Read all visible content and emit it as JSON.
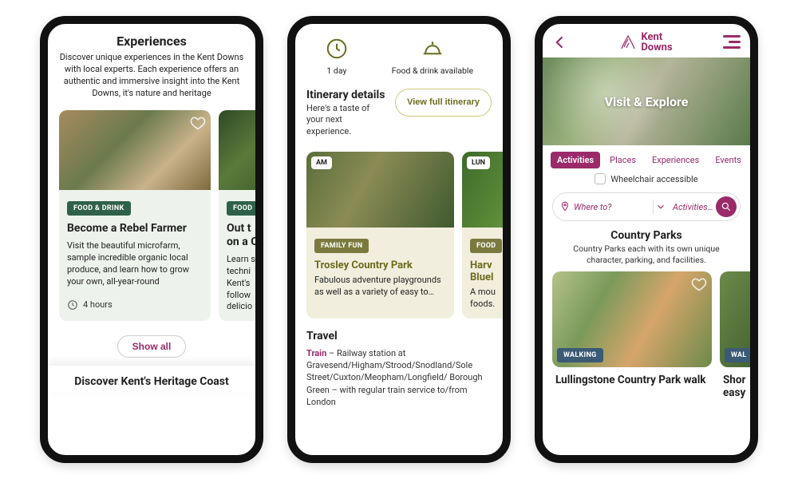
{
  "phone1": {
    "section_title": "Experiences",
    "section_desc": "Discover unique experiences in the Kent Downs with local experts. Each experience offers an authentic and immersive insight into the Kent Downs, it's nature and heritage",
    "card1": {
      "tag": "FOOD & DRINK",
      "title": "Become a Rebel Farmer",
      "desc": "Visit the beautiful microfarm, sample incredible organic local produce, and learn how to grow your own, all-year-round",
      "duration": "4 hours"
    },
    "card2": {
      "tag": "FOOD",
      "title_line1": "Out t",
      "title_line2": "on a C",
      "desc": "Learn s\ntechni\nKent's\nfollow\ndelicio"
    },
    "showall": "Show all",
    "footer_title": "Discover Kent's Heritage Coast"
  },
  "phone2": {
    "info1": "1 day",
    "info2": "Food & drink available",
    "it_title": "Itinerary details",
    "it_sub": "Here's a taste of your next experience.",
    "view_btn": "View full itinerary",
    "card1": {
      "time": "AM",
      "tag": "FAMILY FUN",
      "title": "Trosley Country Park",
      "desc": "Fabulous adventure playgrounds as well as a variety of easy to…"
    },
    "card2": {
      "time": "LUN",
      "tag": "FOOD",
      "title_line1": "Harv",
      "title_line2": "Bluel",
      "desc": "A mou\nfoods."
    },
    "travel_heading": "Travel",
    "travel_mode": "Train",
    "travel_body": " – Railway station at Gravesend/Higham/Strood/Snodland/Sole Street/Cuxton/Meopham/Longfield/ Borough Green – with regular train service to/from London"
  },
  "phone3": {
    "brand_line1": "Kent",
    "brand_line2": "Downs",
    "hero": "Visit & Explore",
    "tabs": [
      "Activities",
      "Places",
      "Experiences",
      "Events"
    ],
    "wc_label": "Wheelchair accessible",
    "where_ph": "Where to?",
    "act_ph": "Activities…",
    "sec_title": "Country Parks",
    "sec_desc": "Country Parks each with its own unique character, parking, and facilities.",
    "card1": {
      "tag": "WALKING",
      "title": "Lullingstone Country Park walk"
    },
    "card2": {
      "tag": "WAL",
      "title_line1": "Shor",
      "title_line2": "easy"
    }
  }
}
